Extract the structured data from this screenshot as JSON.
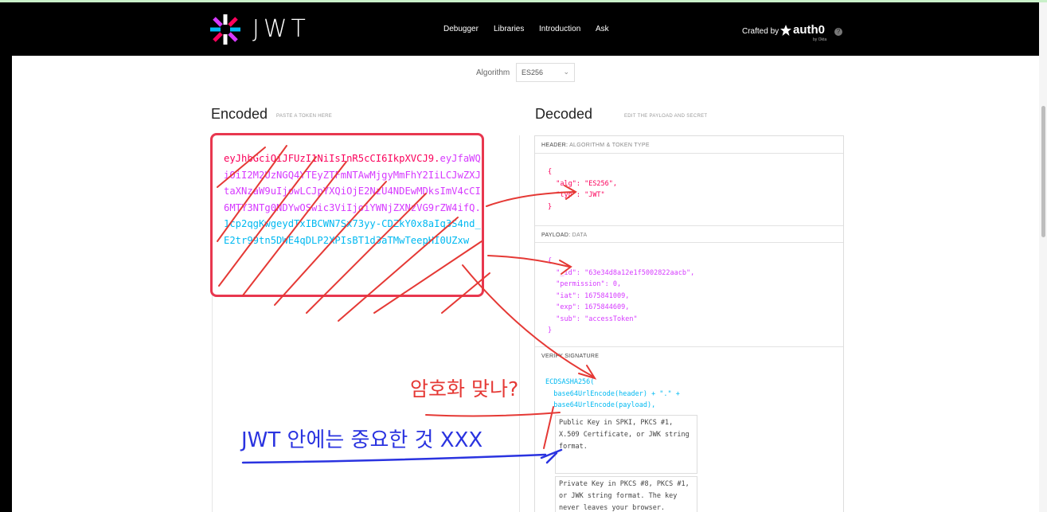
{
  "nav": {
    "brand": "JWT",
    "links": [
      "Debugger",
      "Libraries",
      "Introduction",
      "Ask"
    ],
    "crafted_by": "Crafted by",
    "auth0": "auth0",
    "okta": "by Okta"
  },
  "algorithm": {
    "label": "Algorithm",
    "value": "ES256"
  },
  "encoded": {
    "title": "Encoded",
    "subtitle": "PASTE A TOKEN HERE",
    "token_header": "eyJhbGciOiJFUzI1NiIsInR5cCI6IkpXVCJ9",
    "token_payload": "eyJfaWQiOiI2M2UzNGQ4YTEyZTFmNTAwMjgyMmFhY2IiLCJwZXJtaXNzaW9uIjowLCJpYXQiOjE2NzU4NDEwMDksImV4cCI6MTY3NTg0NDYwOSwic3ViIjoiYWNjZXNzVG9rZW4ifQ",
    "token_signature": "1cp2qgKwgeydTxIBCWN7Sx73yy-CDZkY0x8aIq3S4nd_E2tr99tn5DWE4qDLP2XPIsBT1d3aTMwTeepHI0UZxw"
  },
  "decoded": {
    "title": "Decoded",
    "subtitle": "EDIT THE PAYLOAD AND SECRET",
    "header_label": "HEADER:",
    "header_sub": "ALGORITHM & TOKEN TYPE",
    "payload_label": "PAYLOAD:",
    "payload_sub": "DATA",
    "verify_label": "VERIFY SIGNATURE",
    "header_json": {
      "alg": "\"ES256\"",
      "typ": "\"JWT\""
    },
    "payload_json": {
      "_id": "\"63e34d8a12e1f5002822aacb\"",
      "permission": "0",
      "iat": "1675841009",
      "exp": "1675844609",
      "sub": "\"accessToken\""
    },
    "verify_fn": "ECDSASHA256(",
    "verify_line1": "base64UrlEncode(header) + \".\" +",
    "verify_line2": "base64UrlEncode(payload),",
    "public_key_placeholder": "Public Key in SPKI, PKCS #1, X.509 Certificate, or JWK string format.",
    "private_key_placeholder": "Private Key in PKCS #8, PKCS #1, or JWK string format. The key never leaves your browser."
  },
  "annotations": {
    "question": "암호화 맞나?",
    "note": "JWT 안에는 중요한 것 XXX"
  },
  "colors": {
    "header": "#fb015b",
    "payload": "#d63aff",
    "signature": "#00b9f1",
    "annotation_red": "#e53935",
    "annotation_blue": "#2a33e0"
  }
}
